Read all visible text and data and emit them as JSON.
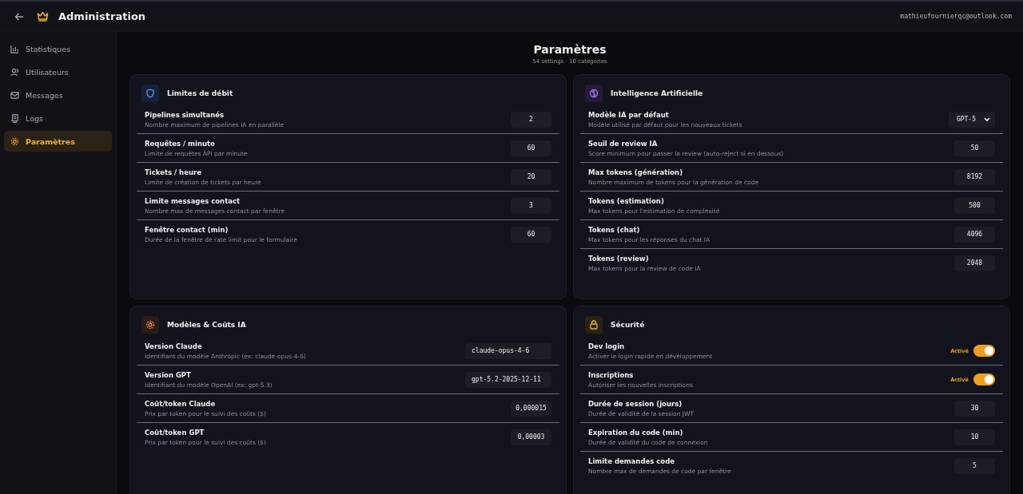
{
  "header": {
    "title": "Administration",
    "user_email": "mathieufournierqc@outlook.com"
  },
  "sidebar": {
    "items": [
      {
        "label": "Statistiques",
        "selected": false
      },
      {
        "label": "Utilisateurs",
        "selected": false
      },
      {
        "label": "Messages",
        "selected": false
      },
      {
        "label": "Logs",
        "selected": false
      },
      {
        "label": "Paramètres",
        "selected": true
      }
    ]
  },
  "page": {
    "title": "Paramètres",
    "subtitle": "54 settings · 10 categories"
  },
  "cards": [
    {
      "title": "Limites de débit",
      "settings": [
        {
          "kind": "input",
          "label": "Pipelines simultanés",
          "description": "Nombre maximum de pipelines IA en parallèle",
          "value": "2"
        },
        {
          "kind": "input",
          "label": "Requêtes / minute",
          "description": "Limite de requêtes API par minute",
          "value": "60"
        },
        {
          "kind": "input",
          "label": "Tickets / heure",
          "description": "Limite de création de tickets par heure",
          "value": "20"
        },
        {
          "kind": "input",
          "label": "Limite messages contact",
          "description": "Nombre max de messages contact par fenêtre",
          "value": "3"
        },
        {
          "kind": "input",
          "label": "Fenêtre contact (min)",
          "description": "Durée de la fenêtre de rate limit pour le formulaire",
          "value": "60"
        }
      ]
    },
    {
      "title": "Intelligence Artificielle",
      "settings": [
        {
          "kind": "select",
          "label": "Modèle IA par défaut",
          "description": "Modèle utilisé par défaut pour les nouveaux tickets",
          "value": "GPT-5"
        },
        {
          "kind": "input",
          "label": "Seuil de review IA",
          "description": "Score minimum pour passer la review (auto-reject si en dessous)",
          "value": "50"
        },
        {
          "kind": "input",
          "label": "Max tokens (génération)",
          "description": "Nombre maximum de tokens pour la génération de code",
          "value": "8192"
        },
        {
          "kind": "input",
          "label": "Tokens (estimation)",
          "description": "Max tokens pour l'estimation de complexité",
          "value": "500"
        },
        {
          "kind": "input",
          "label": "Tokens (chat)",
          "description": "Max tokens pour les réponses du chat IA",
          "value": "4096"
        },
        {
          "kind": "input",
          "label": "Tokens (review)",
          "description": "Max tokens pour la review de code IA",
          "value": "2048"
        }
      ]
    },
    {
      "title": "Modèles & Coûts IA",
      "settings": [
        {
          "kind": "text",
          "label": "Version Claude",
          "description": "Identifiant du modèle Anthropic (ex: claude-opus-4-6)",
          "value": "claude-opus-4-6"
        },
        {
          "kind": "text",
          "label": "Version GPT",
          "description": "Identifiant du modèle OpenAI (ex: gpt-5.3)",
          "value": "gpt-5.2-2025-12-11"
        },
        {
          "kind": "input",
          "label": "Coût/token Claude",
          "description": "Prix par token pour le suivi des coûts ($)",
          "value": "0,000015"
        },
        {
          "kind": "input",
          "label": "Coût/token GPT",
          "description": "Prix par token pour le suivi des coûts ($)",
          "value": "0,00003"
        }
      ]
    },
    {
      "title": "Sécurité",
      "settings": [
        {
          "kind": "toggle",
          "label": "Dev login",
          "description": "Activer le login rapide en développement",
          "on": true,
          "state_label": "Activé"
        },
        {
          "kind": "toggle",
          "label": "Inscriptions",
          "description": "Autoriser les nouvelles inscriptions",
          "on": true,
          "state_label": "Activé"
        },
        {
          "kind": "input",
          "label": "Durée de session (jours)",
          "description": "Durée de validité de la session JWT",
          "value": "30"
        },
        {
          "kind": "input",
          "label": "Expiration du code (min)",
          "description": "Durée de validité du code de connexion",
          "value": "10"
        },
        {
          "kind": "input",
          "label": "Limite demandes code",
          "description": "Nombre max de demandes de code par fenêtre",
          "value": "5"
        }
      ]
    }
  ]
}
